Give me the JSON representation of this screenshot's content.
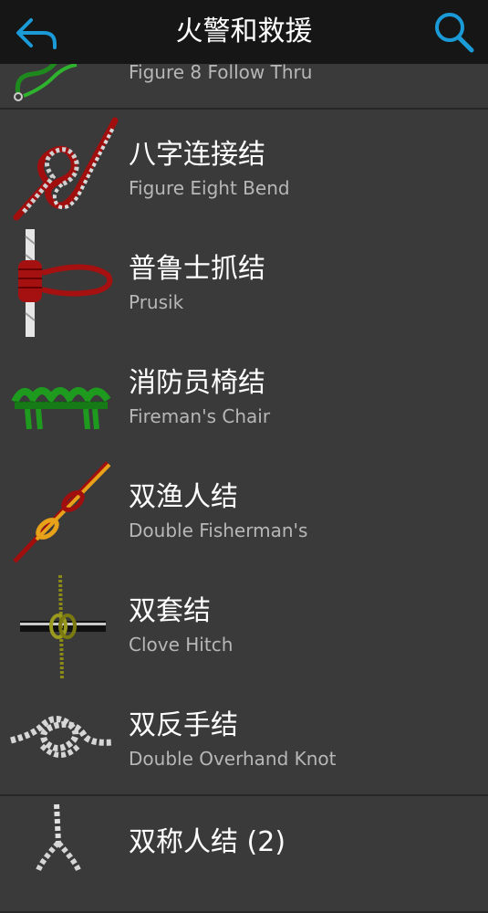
{
  "header": {
    "title": "火警和救援",
    "back_icon": "back-arrow-icon",
    "search_icon": "search-icon",
    "accent": "#1a9bd7"
  },
  "knots": [
    {
      "name": "",
      "subtitle": "Figure 8 Follow Thru",
      "icon": "figure-8-follow-thru-knot-icon"
    },
    {
      "name": "八字连接结",
      "subtitle": "Figure Eight Bend",
      "icon": "figure-eight-bend-knot-icon"
    },
    {
      "name": "普鲁士抓结",
      "subtitle": "Prusik",
      "icon": "prusik-knot-icon"
    },
    {
      "name": "消防员椅结",
      "subtitle": "Fireman's Chair",
      "icon": "firemans-chair-knot-icon"
    },
    {
      "name": "双渔人结",
      "subtitle": "Double Fisherman's",
      "icon": "double-fishermans-knot-icon"
    },
    {
      "name": "双套结",
      "subtitle": "Clove Hitch",
      "icon": "clove-hitch-knot-icon"
    },
    {
      "name": "双反手结",
      "subtitle": "Double Overhand Knot",
      "icon": "double-overhand-knot-icon"
    },
    {
      "name": "双称人结 (2)",
      "subtitle": "",
      "icon": "double-bowline-knot-icon"
    }
  ]
}
